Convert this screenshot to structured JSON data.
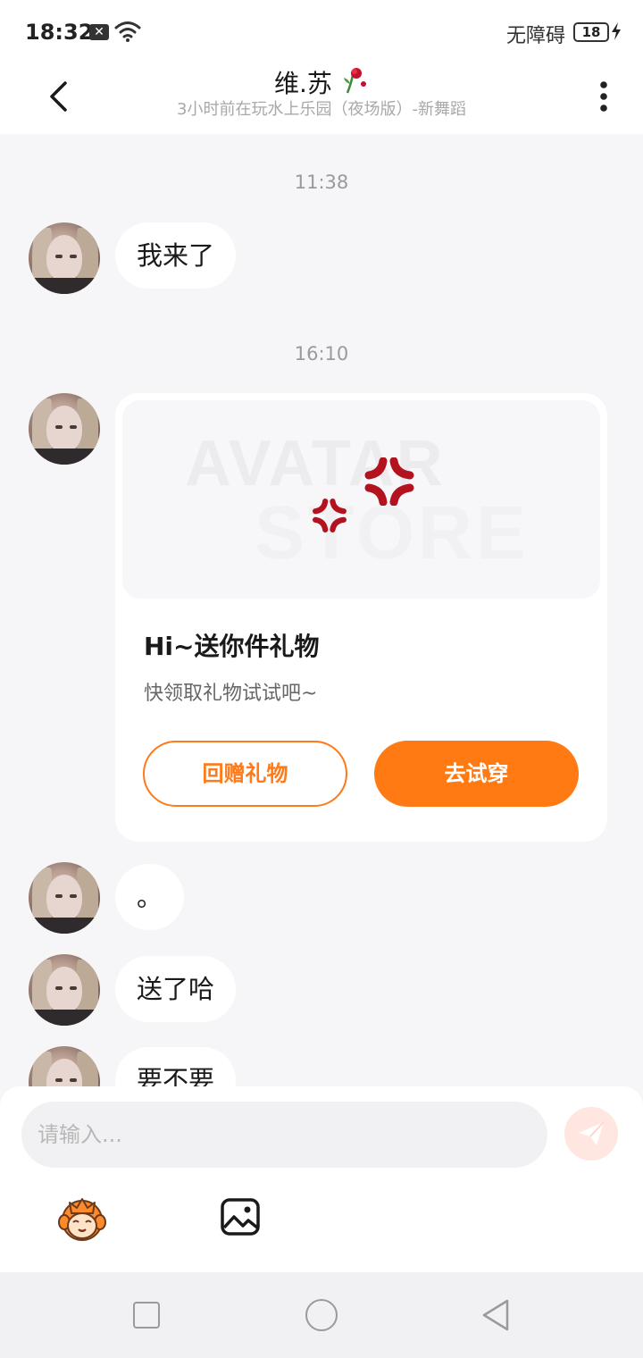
{
  "status_bar": {
    "time": "18:32",
    "notification_glyph": "✕",
    "accessibility": "无障碍",
    "battery": "18",
    "icons": [
      "close-notification-icon",
      "wifi-icon",
      "battery-icon",
      "charging-icon"
    ]
  },
  "header": {
    "title": "维.苏",
    "subtitle": "3小时前在玩水上乐园（夜场版）-新舞蹈",
    "icons": [
      "back-arrow-icon",
      "rose-icon",
      "more-vertical-icon"
    ]
  },
  "messages": {
    "time_1": "11:38",
    "msg_1": "我来了",
    "time_2": "16:10",
    "gift_card": {
      "banner_line_1": "AVATAR",
      "banner_line_2": "STORE",
      "title": "Hi~送你件礼物",
      "subtitle": "快领取礼物试试吧~",
      "return_gift_label": "回赠礼物",
      "try_on_label": "去试穿"
    },
    "msg_2": "。",
    "msg_3": "送了哈",
    "msg_4": "要不要"
  },
  "input": {
    "placeholder": "请输入..."
  },
  "toolbar": {
    "icons": [
      "send-icon",
      "emoji-mascot-icon",
      "image-icon"
    ]
  },
  "nav": {
    "icons": [
      "recent-apps-icon",
      "home-icon",
      "back-icon"
    ]
  },
  "colors": {
    "accent": "#ff7a12",
    "background": "#f6f6f8",
    "bubble": "#ffffff"
  }
}
